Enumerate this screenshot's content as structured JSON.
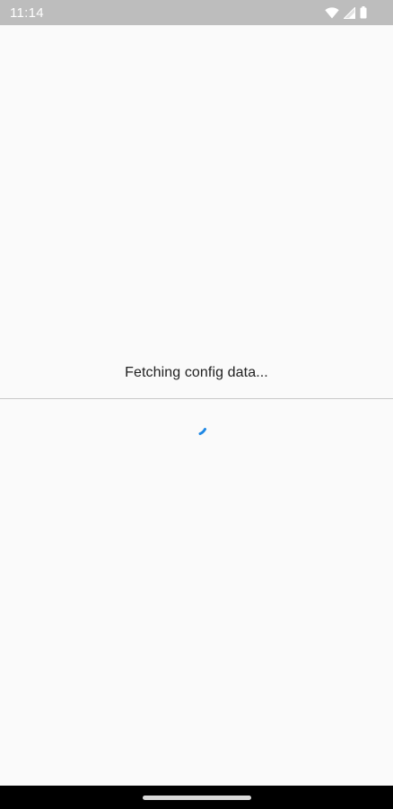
{
  "status_bar": {
    "time": "11:14",
    "icons": [
      "wifi-icon",
      "cellular-signal-icon",
      "battery-icon"
    ]
  },
  "main": {
    "loading_message": "Fetching config data..."
  },
  "spinner": {
    "icon": "loading-spinner-icon",
    "color": "#1e88e5"
  },
  "navigation_bar": {
    "icon": "home-handle"
  }
}
